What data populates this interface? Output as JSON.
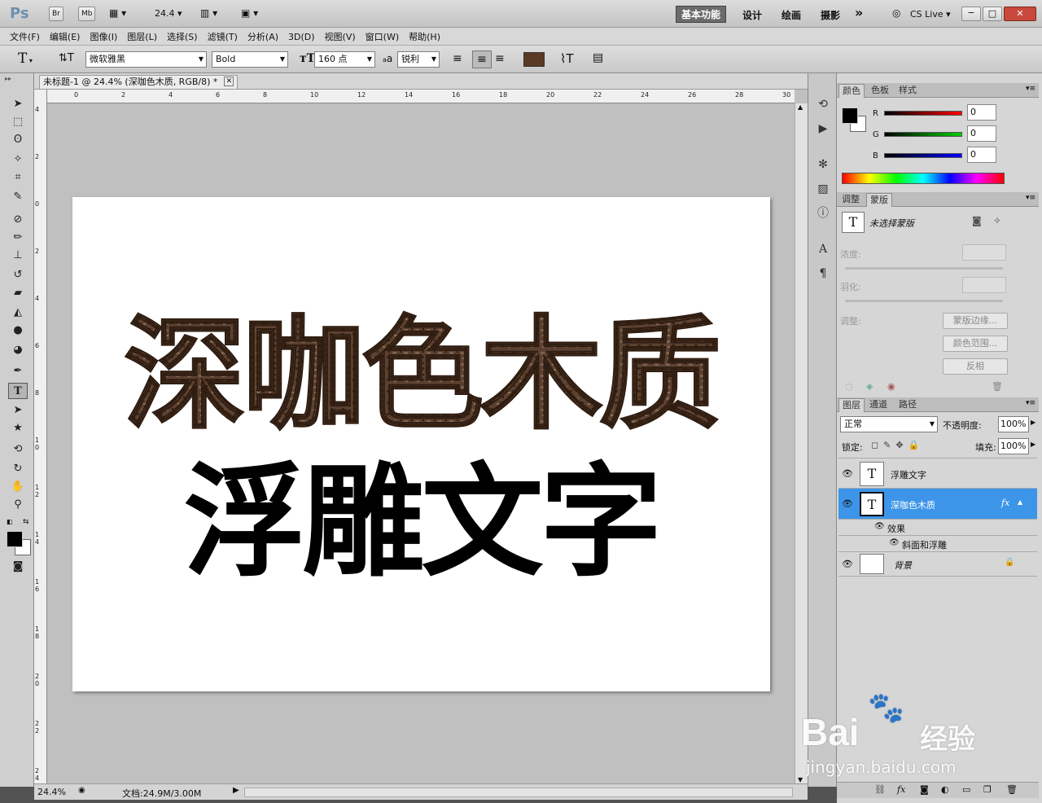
{
  "app_bar": {
    "logo": "Ps",
    "bridge_btn": "Br",
    "minibridge_btn": "Mb",
    "zoom_value": "24.4",
    "workspaces": [
      "基本功能",
      "设计",
      "绘画",
      "摄影"
    ],
    "more": "»",
    "cs_live": "CS Live",
    "window_buttons": [
      "−",
      "□",
      "✕"
    ]
  },
  "menu": [
    "文件(F)",
    "编辑(E)",
    "图像(I)",
    "图层(L)",
    "选择(S)",
    "滤镜(T)",
    "分析(A)",
    "3D(D)",
    "视图(V)",
    "窗口(W)",
    "帮助(H)"
  ],
  "options_bar": {
    "tool_glyph": "T",
    "font_family": "微软雅黑",
    "font_style": "Bold",
    "font_size": "160 点",
    "aa_label": "a",
    "antialias": "锐利",
    "text_color": "#5a3a22"
  },
  "document": {
    "tab_title": "未标题-1 @ 24.4% (深咖色木质, RGB/8) *",
    "ruler_h": [
      "0",
      "2",
      "4",
      "6",
      "8",
      "10",
      "12",
      "14",
      "16",
      "18",
      "20",
      "22",
      "24",
      "26",
      "28",
      "30"
    ],
    "ruler_v": [
      "4",
      "2",
      "0",
      "2",
      "4",
      "6",
      "8",
      "1 0",
      "1 2",
      "1 4",
      "1 6",
      "1 8",
      "2 0",
      "2 2",
      "2 4"
    ],
    "line1": "深咖色木质",
    "line2": "浮雕文字",
    "zoom": "24.4%",
    "doc_info": "文档:24.9M/3.00M"
  },
  "color_panel": {
    "tabs": [
      "颜色",
      "色板",
      "样式"
    ],
    "labels": [
      "R",
      "G",
      "B"
    ],
    "values": [
      "0",
      "0",
      "0"
    ]
  },
  "masks_panel": {
    "tabs": [
      "调整",
      "蒙版"
    ],
    "status": "未选择蒙版",
    "density_label": "浓度:",
    "feather_label": "羽化:",
    "adjust_label": "调整:",
    "buttons": [
      "蒙版边缘...",
      "颜色范围...",
      "反相"
    ]
  },
  "layers_panel": {
    "tabs": [
      "图层",
      "通道",
      "路径"
    ],
    "blend_mode": "正常",
    "opacity_label": "不透明度:",
    "opacity": "100%",
    "lock_label": "锁定:",
    "fill_label": "填充:",
    "fill": "100%",
    "layers": [
      {
        "name": "浮雕文字",
        "thumb": "T"
      },
      {
        "name": "深咖色木质",
        "thumb": "T",
        "fx": "fx"
      },
      {
        "name": "效果"
      },
      {
        "name": "斜面和浮雕"
      },
      {
        "name": "背景"
      }
    ]
  },
  "watermark": {
    "brand": "Bai",
    "brand2": "经验",
    "url": "jingyan.baidu.com"
  }
}
